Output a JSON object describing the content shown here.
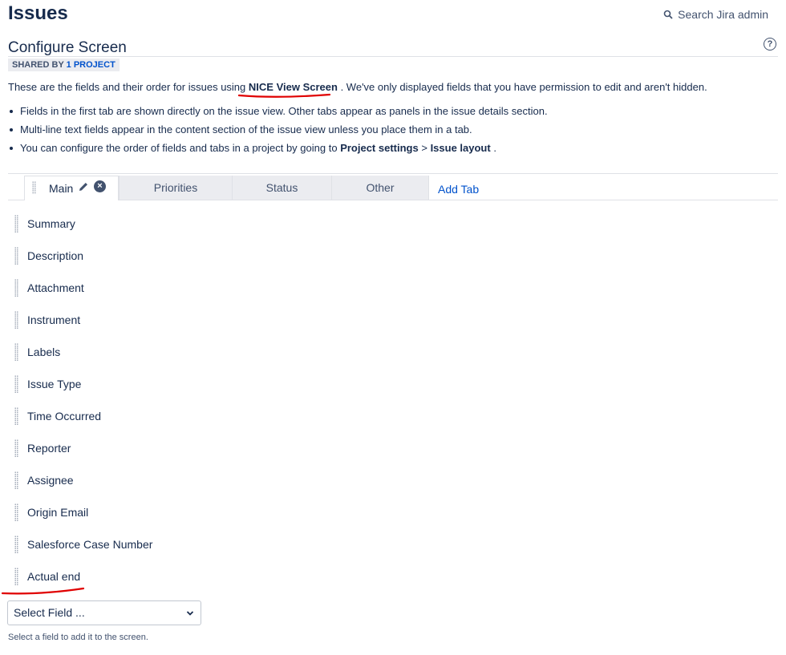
{
  "header": {
    "title": "Issues",
    "search_label": "Search Jira admin"
  },
  "screen": {
    "title": "Configure Screen",
    "help_glyph": "?",
    "shared_prefix": "SHARED BY",
    "shared_link": "1 PROJECT",
    "intro_before": "These are the fields and their order for issues using",
    "intro_screen_name": "NICE View Screen",
    "intro_after": ". We've only displayed fields that you have permission to edit and aren't hidden.",
    "bullets": [
      {
        "text": "Fields in the first tab are shown directly on the issue view. Other tabs appear as panels in the issue details section."
      },
      {
        "text": "Multi-line text fields appear in the content section of the issue view unless you place them in a tab."
      },
      {
        "text_before": "You can configure the order of fields and tabs in a project by going to",
        "bold1": "Project settings",
        "sep": ">",
        "bold2": "Issue layout",
        "text_after": "."
      }
    ]
  },
  "tabs": [
    {
      "label": "Main"
    },
    {
      "label": "Priorities"
    },
    {
      "label": "Status"
    },
    {
      "label": "Other"
    }
  ],
  "add_tab_label": "Add Tab",
  "fields": [
    {
      "label": "Summary"
    },
    {
      "label": "Description"
    },
    {
      "label": "Attachment"
    },
    {
      "label": "Instrument"
    },
    {
      "label": "Labels"
    },
    {
      "label": "Issue Type"
    },
    {
      "label": "Time Occurred"
    },
    {
      "label": "Reporter"
    },
    {
      "label": "Assignee"
    },
    {
      "label": "Origin Email"
    },
    {
      "label": "Salesforce Case Number"
    },
    {
      "label": "Actual end"
    }
  ],
  "select_field": {
    "value": "Select Field ...",
    "hint": "Select a field to add it to the screen."
  },
  "colors": {
    "link": "#0052cc",
    "text": "#172b4d",
    "annotation": "#e00000"
  },
  "icons": {
    "search": "search-icon",
    "help": "help-icon",
    "edit": "pencil-icon",
    "remove": "remove-circle-icon",
    "drag": "drag-handle-icon"
  }
}
